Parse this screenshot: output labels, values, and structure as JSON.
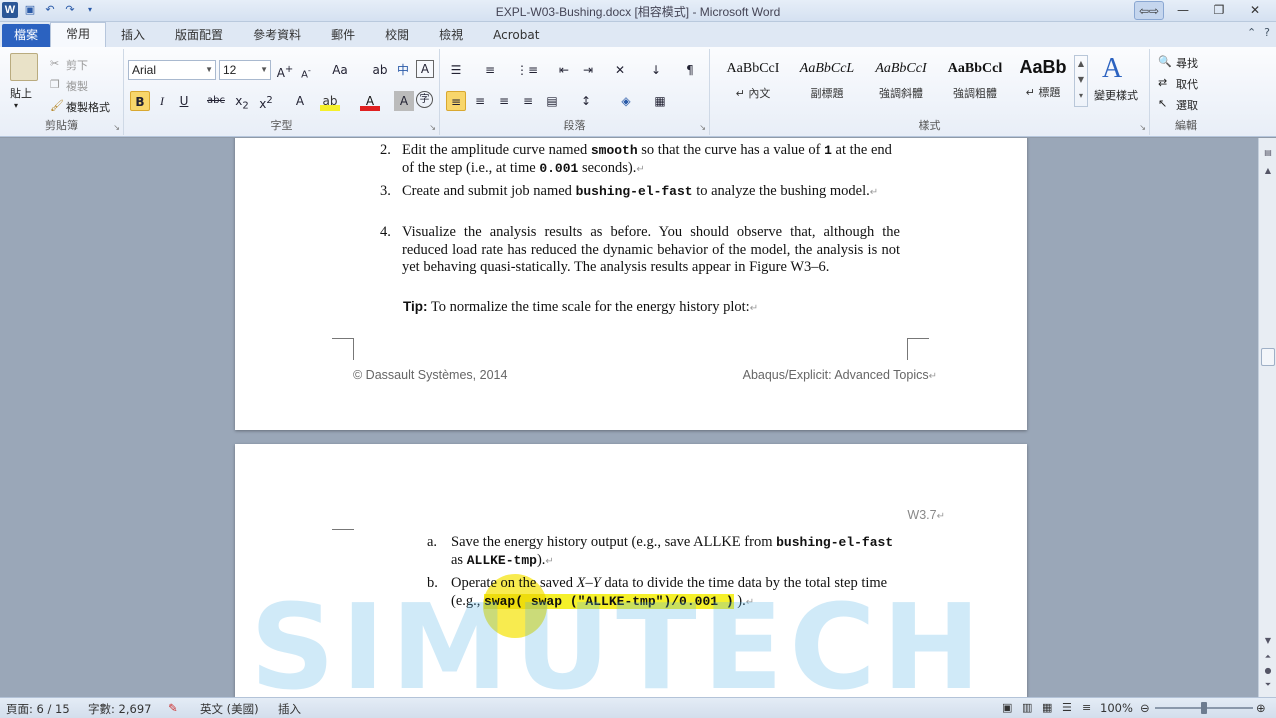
{
  "window": {
    "title": "EXPL-W03-Bushing.docx [相容模式] - Microsoft Word",
    "buttons": [
      "⇦⇨",
      "—",
      "❐",
      "✕"
    ]
  },
  "tabs": [
    "檔案",
    "常用",
    "插入",
    "版面配置",
    "參考資料",
    "郵件",
    "校閱",
    "檢視",
    "Acrobat"
  ],
  "active_tab": "常用",
  "ribbon": {
    "clipboard": {
      "paste": "貼上",
      "cut": "剪下",
      "copy": "複製",
      "format_painter": "複製格式",
      "label": "剪貼簿"
    },
    "font": {
      "name": "Arial",
      "size": "12",
      "label": "字型"
    },
    "paragraph": {
      "label": "段落"
    },
    "styles": {
      "label": "樣式",
      "items": [
        {
          "sample": "AaBbCcI",
          "name": "↵ 內文"
        },
        {
          "sample": "AaBbCcL",
          "name": "副標題"
        },
        {
          "sample": "AaBbCcI",
          "name": "強調斜體"
        },
        {
          "sample": "AaBbCcl",
          "name": "強調粗體"
        },
        {
          "sample": "AaBb",
          "name": "↵ 標題"
        }
      ],
      "change_styles": "變更樣式"
    },
    "editing": {
      "find": "尋找",
      "replace": "取代",
      "select": "選取",
      "label": "編輯"
    }
  },
  "page1": {
    "items": [
      {
        "num": "2.",
        "parts": [
          "Edit the amplitude curve named ",
          "smooth",
          " so that the curve has a value of ",
          "1",
          " at the end of the step (i.e., at time ",
          "0.001",
          " seconds)."
        ]
      },
      {
        "num": "3.",
        "parts": [
          "Create and submit job named ",
          "bushing-el-fast",
          " to analyze the bushing model."
        ]
      },
      {
        "num": "4.",
        "text": "Visualize the analysis results as before. You should observe that, although the reduced load rate has reduced the dynamic behavior of the model, the analysis is not yet behaving quasi-statically. The analysis results appear in Figure W3–6."
      }
    ],
    "tip_label": "Tip:",
    "tip_text": " To normalize the time scale for the energy history plot:",
    "footer_left": "© Dassault Systèmes, 2014",
    "footer_right": "Abaqus/Explicit: Advanced Topics"
  },
  "page2": {
    "header": "W3.7",
    "items": [
      {
        "num": "a.",
        "pre": "Save the energy history output (e.g., save ALLKE from ",
        "code1": "bushing-el-fast",
        "mid": " as ",
        "code2": "ALLKE-tmp",
        "post": ")."
      },
      {
        "num": "b.",
        "pre": "Operate on the saved ",
        "xy": "X–Y",
        "mid": " data to divide the time data by the total step time (e.g., ",
        "code": "swap( swap (\"ALLKE-tmp\")/0.001 )",
        "post": " )."
      }
    ]
  },
  "watermark": "SIMUTECH",
  "status": {
    "page": "頁面: 6 / 15",
    "words": "字數: 2,697",
    "language": "英文 (美國)",
    "mode": "插入",
    "zoom": "100%",
    "zoom_level": 0.5
  }
}
